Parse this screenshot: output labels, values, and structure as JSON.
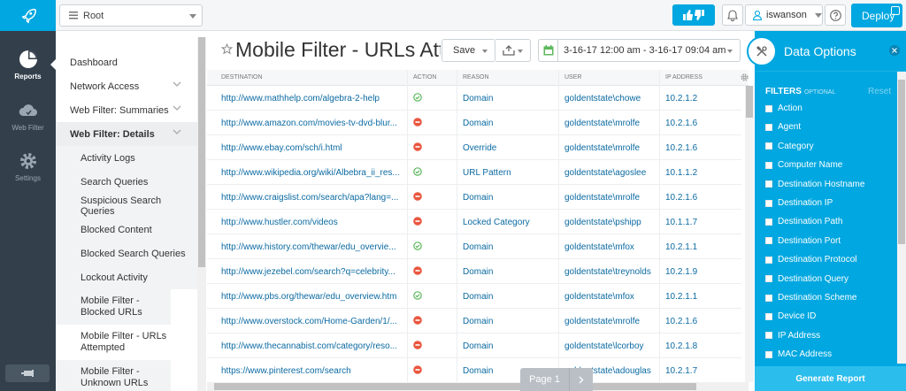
{
  "app": {
    "logo_icon": "rocket-icon",
    "accent_color": "#00a7e0",
    "rail": [
      {
        "label": "Reports",
        "icon": "pie-chart-icon",
        "active": true
      },
      {
        "label": "Web Filter",
        "icon": "cloud-icon",
        "active": false
      },
      {
        "label": "Settings",
        "icon": "gear-icon",
        "active": false
      }
    ],
    "pin_icon": "pin-icon"
  },
  "topbar": {
    "root_select": "Root",
    "feedback_icon": "thumbs-up-down-icon",
    "bell_icon": "bell-icon",
    "username": "iswanson",
    "help_icon": "question-icon",
    "deploy_label": "Deploy"
  },
  "sidebar": {
    "items": [
      {
        "label": "Dashboard",
        "level": 1
      },
      {
        "label": "Network Access",
        "level": 1,
        "chevron": true
      },
      {
        "label": "Web Filter: Summaries",
        "level": 1,
        "chevron": true
      },
      {
        "label": "Web Filter: Details",
        "level": 1,
        "chevron": true,
        "bold": true
      },
      {
        "label": "Activity Logs",
        "level": 2
      },
      {
        "label": "Search Queries",
        "level": 2
      },
      {
        "label": "Suspicious Search Queries",
        "level": 2
      },
      {
        "label": "Blocked Content",
        "level": 2
      },
      {
        "label": "Blocked Search Queries",
        "level": 2
      },
      {
        "label": "Lockout Activity",
        "level": 2
      },
      {
        "label": "Mobile Filter - Blocked URLs",
        "level": 2,
        "two_line": true
      },
      {
        "label": "Mobile Filter - URLs Attempted",
        "level": 2,
        "two_line": true,
        "selected": true
      },
      {
        "label": "Mobile Filter - Unknown URLs",
        "level": 2,
        "two_line": true
      }
    ]
  },
  "report": {
    "title": "Mobile Filter - URLs Attempted",
    "save_label": "Save",
    "export_icon": "export-icon",
    "calendar_icon": "calendar-icon",
    "date_range": "3-16-17 12:00 am - 3-16-17 09:04 am"
  },
  "table": {
    "columns": [
      "Destination",
      "Action",
      "Reason",
      "User",
      "IP Address"
    ],
    "settings_icon": "gear-icon",
    "rows": [
      {
        "destination": "http://www.mathhelp.com/algebra-2-help",
        "action": "allowed",
        "reason": "Domain",
        "user": "goldentstate\\chowe",
        "ip": "10.2.1.2"
      },
      {
        "destination": "http://www.amazon.com/movies-tv-dvd-blur...",
        "action": "blocked",
        "reason": "Domain",
        "user": "goldentstate\\mrolfe",
        "ip": "10.2.1.6"
      },
      {
        "destination": "http://www.ebay.com/sch/i.html",
        "action": "blocked",
        "reason": "Override",
        "user": "goldentstate\\mrolfe",
        "ip": "10.2.1.6"
      },
      {
        "destination": "http://www.wikipedia.org/wiki/Albebra_ii_res...",
        "action": "allowed",
        "reason": "URL Pattern",
        "user": "goldentstate\\agoslee",
        "ip": "10.1.1.2"
      },
      {
        "destination": "http://www.craigslist.com/search/apa?lang=...",
        "action": "blocked",
        "reason": "Domain",
        "user": "goldentstate\\mrolfe",
        "ip": "10.2.1.6"
      },
      {
        "destination": "http://www.hustler.com/videos",
        "action": "blocked",
        "reason": "Locked Category",
        "user": "goldentstate\\pshipp",
        "ip": "10.1.1.7"
      },
      {
        "destination": "http://www.history.com/thewar/edu_overvie...",
        "action": "allowed",
        "reason": "Domain",
        "user": "goldentstate\\mfox",
        "ip": "10.2.1.1"
      },
      {
        "destination": "http://www.jezebel.com/search?q=celebrity...",
        "action": "blocked",
        "reason": "Domain",
        "user": "goldentstate\\treynolds",
        "ip": "10.2.1.9"
      },
      {
        "destination": "http://www.pbs.org/thewar/edu_overview.htm",
        "action": "allowed",
        "reason": "Domain",
        "user": "goldentstate\\mfox",
        "ip": "10.2.1.1"
      },
      {
        "destination": "http://www.overstock.com/Home-Garden/1/...",
        "action": "blocked",
        "reason": "Domain",
        "user": "goldentstate\\mrolfe",
        "ip": "10.2.1.6"
      },
      {
        "destination": "http://www.thecannabist.com/category/reso...",
        "action": "blocked",
        "reason": "Domain",
        "user": "goldentstate\\lcorboy",
        "ip": "10.2.1.8"
      },
      {
        "destination": "https://www.pinterest.com/search",
        "action": "blocked",
        "reason": "Domain",
        "user": "goldentstate\\adouglas",
        "ip": "10.2.1.7"
      }
    ],
    "allowed_color": "#5cb85c",
    "blocked_color": "#e9573f"
  },
  "pager": {
    "label": "Page 1",
    "next_icon": "chevron-right-icon"
  },
  "panel": {
    "title": "Data Options",
    "tool_icon": "tools-icon",
    "close_icon": "close-icon",
    "filters_label": "FILTERS",
    "filters_sub": "OPTIONAL",
    "reset_label": "Reset",
    "filters": [
      "Action",
      "Agent",
      "Category",
      "Computer Name",
      "Destination Hostname",
      "Destination IP",
      "Destination Path",
      "Destination Port",
      "Destination Protocol",
      "Destination Query",
      "Destination Scheme",
      "Device ID",
      "IP Address",
      "MAC Address"
    ],
    "generate_label": "Generate Report"
  }
}
